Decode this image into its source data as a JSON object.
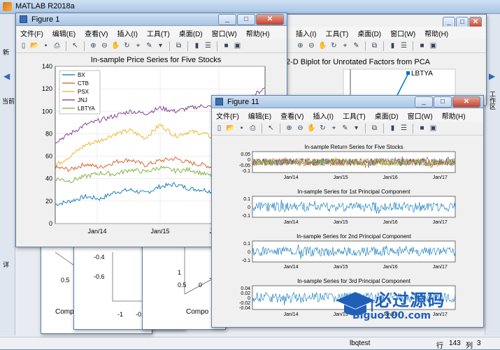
{
  "app": {
    "title": "MATLAB R2018a"
  },
  "status": {
    "command": "lbqtest",
    "row_label": "行",
    "row": "143",
    "col_label": "列",
    "col": "3"
  },
  "side_labels": {
    "left_tab": "当前",
    "left_tab2": "新",
    "left_panel": "详",
    "right_tab": "工作区"
  },
  "menu": [
    "文件(F)",
    "编辑(E)",
    "查看(V)",
    "插入(I)",
    "工具(T)",
    "桌面(D)",
    "窗口(W)",
    "帮助(H)"
  ],
  "back_windows": {
    "biplot_title": "2-D Biplot for Unrotated Factors from PCA",
    "biplot_point_label": "LBTYA",
    "tick_labels_a": [
      "-0.4",
      "-0.6",
      "0.5",
      "-0.4",
      "-1",
      "-0."
    ],
    "tick_labels_b": [
      "1",
      "0.5",
      "0",
      "-1"
    ],
    "component_label": "Compo"
  },
  "figure1": {
    "title": "Figure 1",
    "chart_data": {
      "type": "line",
      "title": "In-sample Price Series for Five Stocks",
      "xlabel": "",
      "ylabel": "",
      "x_ticks": [
        "Jan/14",
        "Jan/15",
        "Jan/16"
      ],
      "ylim": [
        0,
        140
      ],
      "y_ticks": [
        0,
        20,
        40,
        60,
        80,
        100,
        120,
        140
      ],
      "legend_position": "top-left",
      "series": [
        {
          "name": "BX",
          "color": "#0072bd",
          "values": [
            17,
            20,
            24,
            22,
            28,
            30,
            27,
            33,
            35,
            31,
            30,
            26,
            22,
            24,
            22
          ]
        },
        {
          "name": "CTB",
          "color": "#d95319",
          "values": [
            50,
            48,
            53,
            50,
            55,
            57,
            52,
            56,
            58,
            54,
            52,
            48,
            47,
            50,
            53
          ]
        },
        {
          "name": "PSX",
          "color": "#edb120",
          "values": [
            52,
            60,
            70,
            74,
            80,
            83,
            76,
            88,
            78,
            82,
            80,
            72,
            70,
            76,
            82
          ]
        },
        {
          "name": "JNJ",
          "color": "#7e2f8e",
          "values": [
            73,
            80,
            88,
            92,
            96,
            100,
            98,
            103,
            100,
            103,
            105,
            101,
            108,
            112,
            121
          ]
        },
        {
          "name": "LBTYA",
          "color": "#77ac30",
          "values": [
            40,
            38,
            42,
            45,
            44,
            48,
            46,
            50,
            47,
            48,
            44,
            40,
            39,
            40,
            37
          ]
        }
      ]
    }
  },
  "figure11": {
    "title": "Figure 11",
    "subplots": [
      {
        "title": "In-sample Return Series for Five Stocks",
        "y_ticks": [
          "0.05",
          "0",
          "-0.05",
          "-0.1"
        ],
        "ylim": [
          -0.12,
          0.07
        ]
      },
      {
        "title": "In-sample Series for 1st Principal Component",
        "y_ticks": [
          "0.1",
          "0",
          "-0.1"
        ],
        "ylim": [
          -0.12,
          0.12
        ]
      },
      {
        "title": "In-sample Series for 2nd Principal Component",
        "y_ticks": [
          "0.1",
          "0",
          "-0.1"
        ],
        "ylim": [
          -0.12,
          0.12
        ]
      },
      {
        "title": "In-sample Series for 3rd Principal Component",
        "y_ticks": [
          "0.04",
          "0.02",
          "0",
          "-0.02",
          "-0.04"
        ],
        "ylim": [
          -0.045,
          0.045
        ]
      }
    ],
    "x_ticks": [
      "Jan/14",
      "Jan/15",
      "Jan/16",
      "Jan/17"
    ]
  },
  "watermark": {
    "text": "必过源码",
    "url": "Biguo100.com"
  },
  "colors": {
    "line_blue": "#0072bd",
    "titlebar": "#a9c5e6"
  }
}
